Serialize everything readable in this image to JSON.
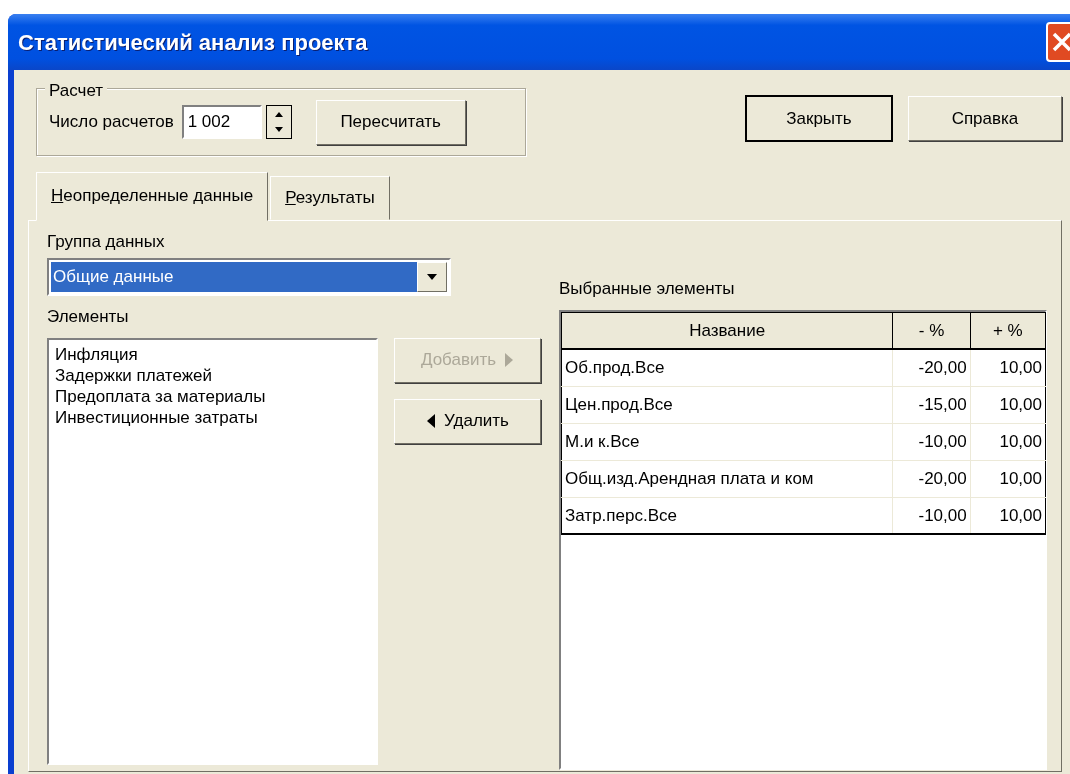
{
  "window": {
    "title": "Статистический анализ проекта"
  },
  "calculation": {
    "legend": "Расчет",
    "count_label": "Число расчетов",
    "count_value": "1 002",
    "recalculate_button": "Пересчитать"
  },
  "dialog_buttons": [
    {
      "label": "Закрыть",
      "default": true
    },
    {
      "label": "Справка",
      "default": false
    }
  ],
  "tabs": [
    {
      "label": "Неопределенные данные",
      "selected": true
    },
    {
      "label": "Результаты",
      "selected": false
    }
  ],
  "data_group": {
    "label": "Группа данных",
    "value": "Общие данные",
    "highlighted": true
  },
  "elements": {
    "label": "Элементы",
    "items": [
      "Инфляция",
      "Задержки платежей",
      "Предоплата за материалы",
      "Инвестиционные затраты"
    ]
  },
  "move_buttons": [
    {
      "label": "Добавить",
      "kind": "add",
      "disabled": true
    },
    {
      "label": "Удалить",
      "kind": "remove",
      "disabled": false
    }
  ],
  "selected_elements": {
    "label": "Выбранные элементы",
    "columns": [
      "Название",
      "- %",
      "+ %"
    ],
    "rows": [
      [
        "Об.прод.Все",
        "-20,00",
        "10,00"
      ],
      [
        "Цен.прод.Все",
        "-15,00",
        "10,00"
      ],
      [
        "М.и к.Все",
        "-10,00",
        "10,00"
      ],
      [
        "Общ.изд.Арендная плата и ком",
        "-20,00",
        "10,00"
      ],
      [
        "Затр.перс.Все",
        "-10,00",
        "10,00"
      ]
    ]
  }
}
